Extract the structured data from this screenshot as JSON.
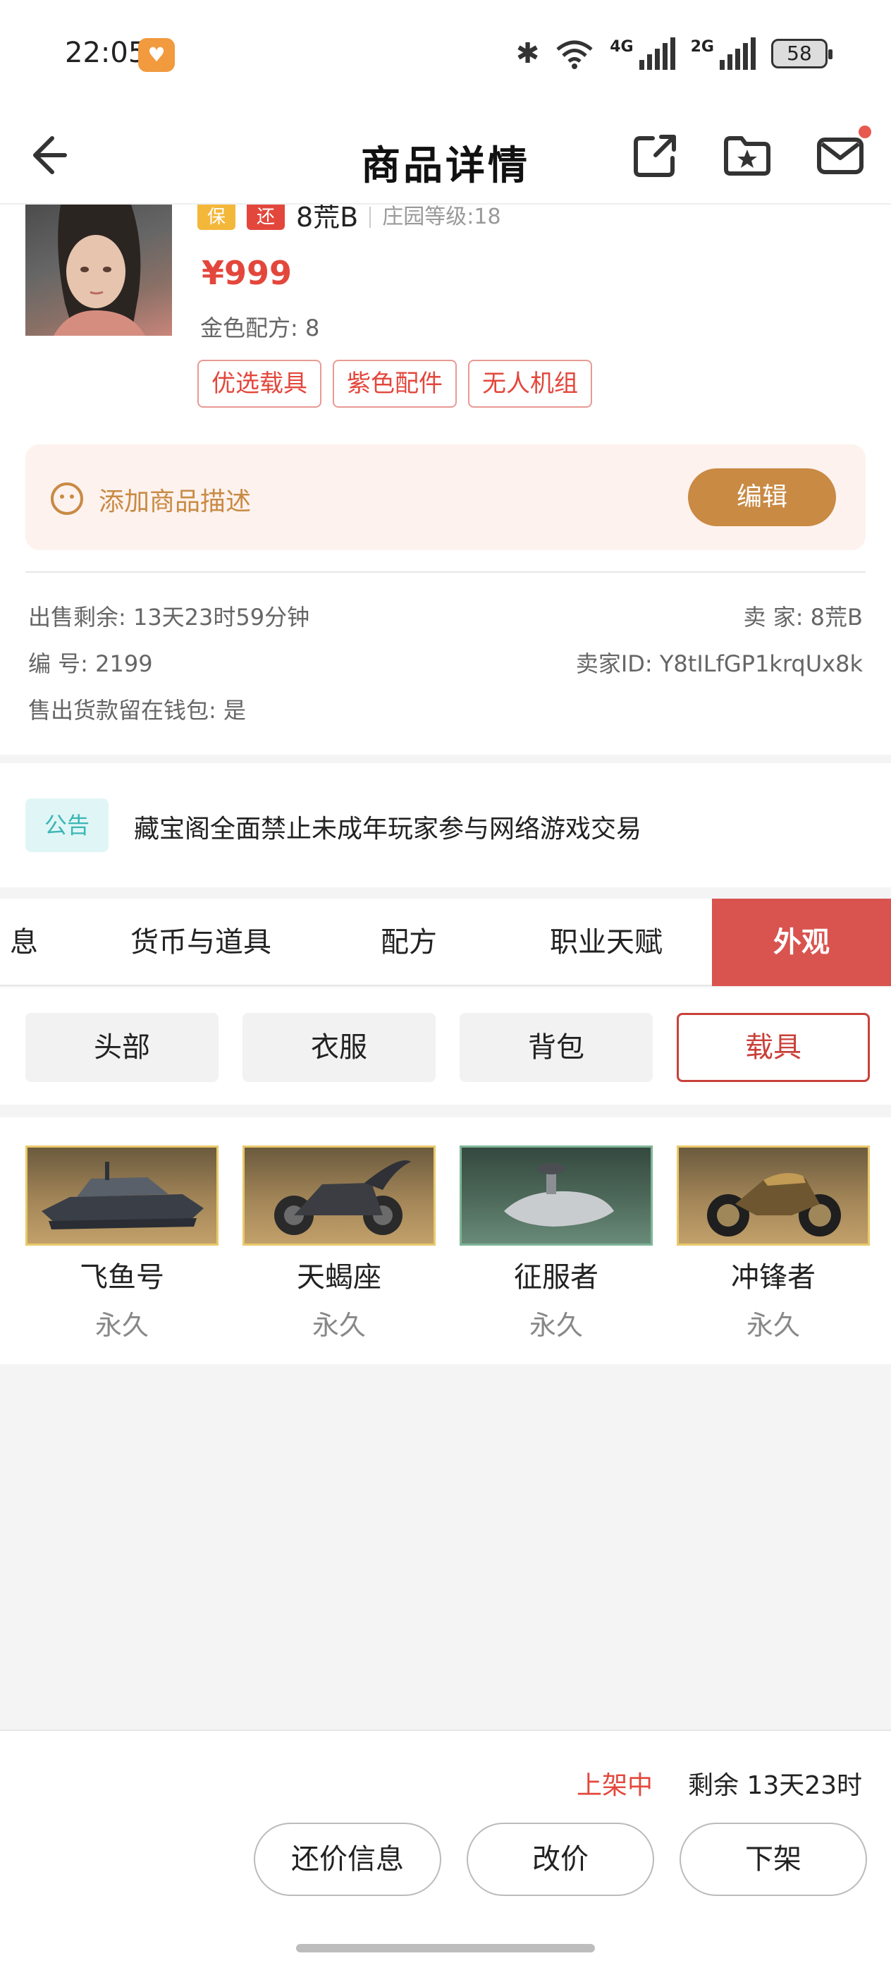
{
  "status_bar": {
    "time": "22:05",
    "bluetooth": "✱",
    "net1": "4G",
    "net2": "2G",
    "battery": "58"
  },
  "header": {
    "title": "商品详情"
  },
  "product": {
    "tag_bao": "保",
    "tag_huan": "还",
    "seller_name": "8荒B",
    "guild_level": "庄园等级:18",
    "price": "¥999",
    "recipe": "金色配方: 8",
    "chips": [
      "优选载具",
      "紫色配件",
      "无人机组"
    ]
  },
  "description": {
    "placeholder": "添加商品描述",
    "edit_label": "编辑"
  },
  "info": {
    "remaining": "出售剩余: 13天23时59分钟",
    "seller": "卖 家: 8荒B",
    "number": "编 号: 2199",
    "seller_id": "卖家ID: Y8tILfGP1krqUx8k",
    "wallet": "售出货款留在钱包: 是"
  },
  "notice": {
    "tag": "公告",
    "text": "藏宝阁全面禁止未成年玩家参与网络游戏交易"
  },
  "tabs": [
    "息",
    "货币与道具",
    "配方",
    "职业天赋",
    "外观"
  ],
  "subcategories": [
    "头部",
    "衣服",
    "背包",
    "载具"
  ],
  "items": [
    {
      "name": "飞鱼号",
      "duration": "永久"
    },
    {
      "name": "天蝎座",
      "duration": "永久"
    },
    {
      "name": "征服者",
      "duration": "永久"
    },
    {
      "name": "冲锋者",
      "duration": "永久"
    }
  ],
  "bottom": {
    "status": "上架中",
    "remaining": "剩余 13天23时",
    "buttons": [
      "还价信息",
      "改价",
      "下架"
    ]
  },
  "colors": {
    "accent_red": "#d9534f",
    "price_red": "#e3473c",
    "gold": "#c98a44"
  }
}
